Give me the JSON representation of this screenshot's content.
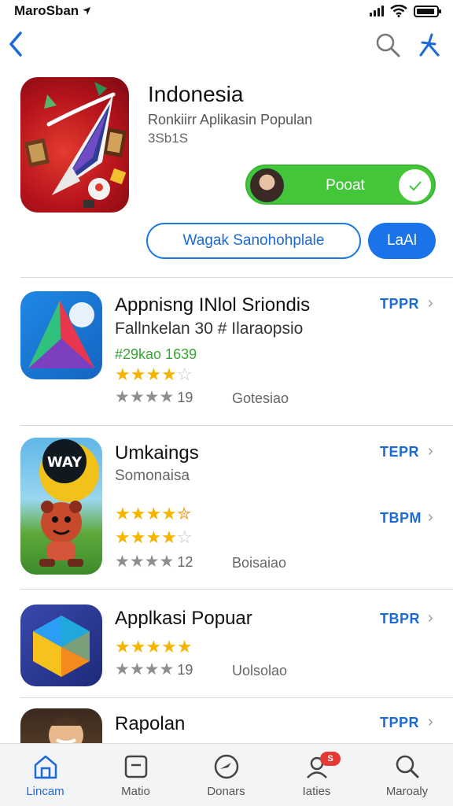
{
  "status_bar": {
    "carrier": "MaroSban",
    "location_icon": "location-arrow-icon",
    "signal_icon": "cellular-signal-icon",
    "wifi_icon": "wifi-icon",
    "battery_icon": "battery-icon"
  },
  "nav": {
    "back_icon": "chevron-left-icon",
    "search_icon": "search-icon",
    "person_icon": "person-icon"
  },
  "hero": {
    "title": "Indonesia",
    "subtitle": "Ronkiirr Aplikasin Populan",
    "meta": "3Sb1S",
    "get_label": "Pooat",
    "secondary_button": "Wagak Sanohohplale",
    "primary_button": "LaAl"
  },
  "apps": [
    {
      "name": "Appnisng INlol Sriondis",
      "line2": "Fallnkelan 30 # Ilaraopsio",
      "green": "#29kao 1639",
      "rating": 4,
      "gray_count": "19",
      "category": "Gotesiao",
      "get_label": "TPPR"
    },
    {
      "name": "Umkaings",
      "line2": "Somonaisa",
      "rating": 4.5,
      "rating2": 4,
      "gray_count": "12",
      "category": "Boisaiao",
      "get_label": "TEPR",
      "get_label_2": "TBPM"
    },
    {
      "name": "Applkasi Popuar",
      "rating": 5,
      "gray_count": "19",
      "category": "Uolsolao",
      "get_label": "TBPR"
    },
    {
      "name": "Rapolan",
      "get_label": "TPPR"
    }
  ],
  "tabs": [
    {
      "label": "Lincam",
      "icon": "home-icon",
      "active": true
    },
    {
      "label": "Matio",
      "icon": "square-app-icon",
      "active": false
    },
    {
      "label": "Donars",
      "icon": "compass-icon",
      "active": false
    },
    {
      "label": "Iaties",
      "icon": "person-badge-icon",
      "active": false,
      "badge": "S"
    },
    {
      "label": "Maroaly",
      "icon": "search-icon",
      "active": false
    }
  ],
  "colors": {
    "accent_blue": "#1a73e8",
    "get_green": "#43c63a",
    "star_gold": "#f5b400",
    "badge_red": "#e53935"
  }
}
